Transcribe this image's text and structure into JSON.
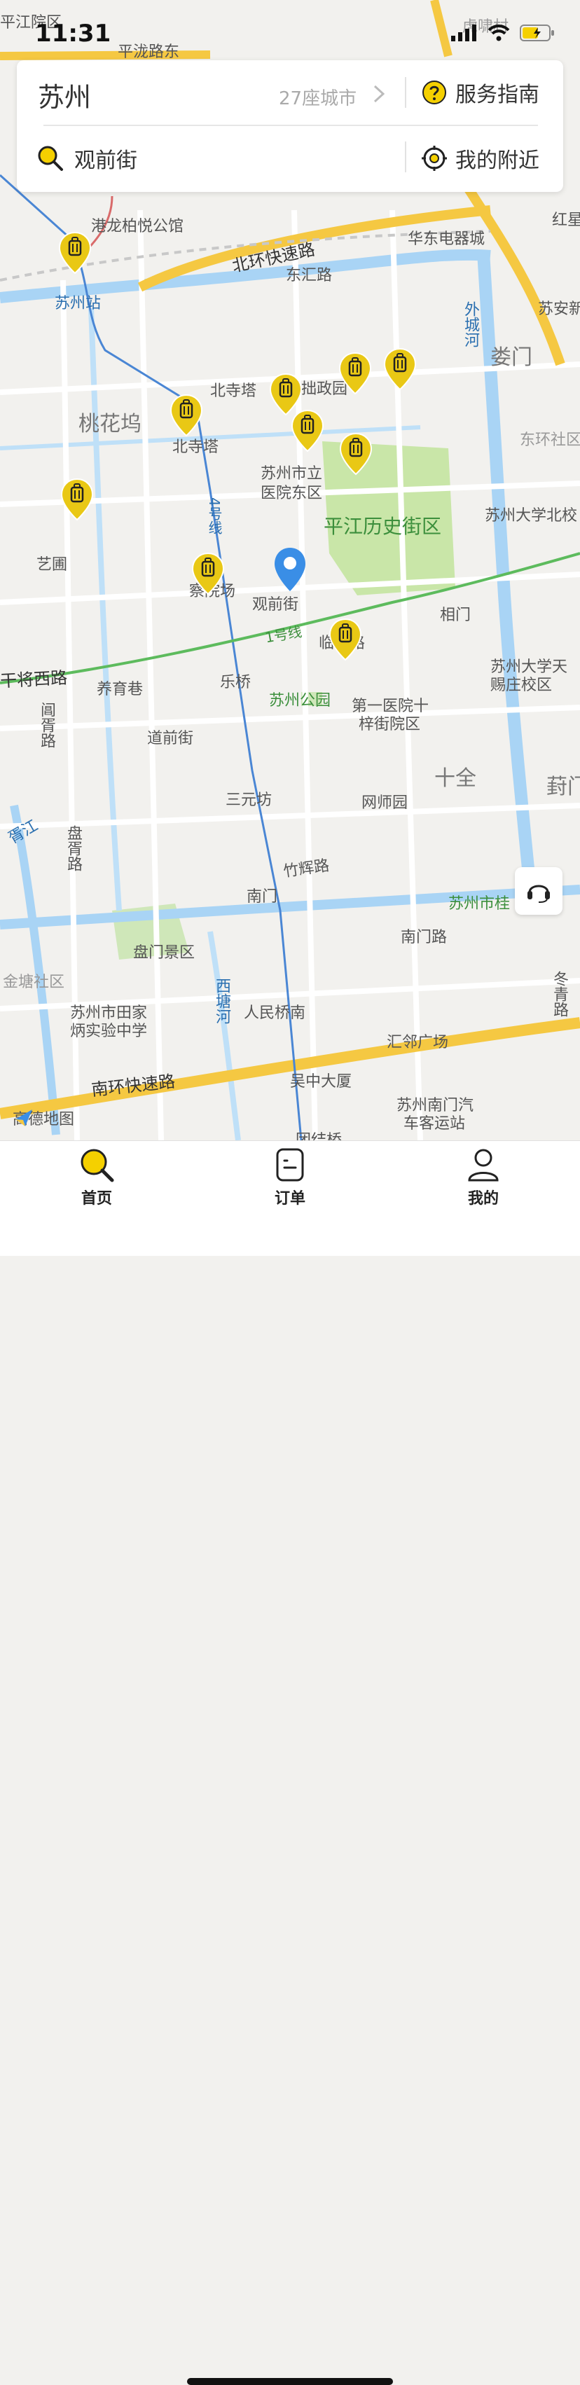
{
  "status_bar": {
    "time": "11:31"
  },
  "header": {
    "city": "苏州",
    "city_count": "27座城市",
    "service_guide": "服务指南",
    "search_value": "观前街",
    "nearby": "我的附近"
  },
  "map": {
    "labels": {
      "gangqlong": "港龙柏悦公馆",
      "suzhou_station": "苏州站",
      "north_ring": "北环快速路",
      "donghui": "东汇路",
      "huadong": "华东电器城",
      "hongxing": "红星",
      "suan": "苏安新",
      "waicheng": "外城河",
      "loumen": "娄门",
      "beisita_poi": "北寺塔",
      "zhuozheng": "拙政园",
      "taohuawu": "桃花坞",
      "beisita_station": "北寺塔",
      "hospital_1": "苏州市立",
      "hospital_2": "医院东区",
      "dongshou": "东环社区",
      "pingjiang": "平江历史街区",
      "suzhou_univ_north": "苏州大学北校",
      "yipu": "艺圃",
      "line4": "4号线",
      "chayuan": "察院场",
      "guanqian": "观前街",
      "line1": "1号线",
      "xiangmen": "相门",
      "lindun": "临顿路",
      "ganjiang": "干将西路",
      "yangyuxiang": "养育巷",
      "leqiao": "乐桥",
      "park": "苏州公园",
      "first_hospital_1": "第一医院十",
      "first_hospital_2": "梓街院区",
      "univ_tianci_1": "苏州大学天",
      "univ_tianci_2": "赐庄校区",
      "changxu": "阊胥路",
      "daoqian": "道前街",
      "shiquan": "十全",
      "fengmen": "葑门",
      "sanyuanfang": "三元坊",
      "wangshi": "网师园",
      "panxu": "盘胥路",
      "xujiang": "胥江",
      "zhuhui": "竹辉路",
      "nanmen": "南门",
      "suzhou_gui": "苏州市桂",
      "nanmen_road": "南门路",
      "panmen": "盘门景区",
      "jintang": "金塘社区",
      "xitang": "西塘河",
      "renmin_bridge": "人民桥南",
      "dongqing": "冬青路",
      "tianjia_1": "苏州市田家",
      "tianjia_2": "炳实验中学",
      "huiling": "汇邻广场",
      "south_ring": "南环快速路",
      "wuzhong": "吴中大厦",
      "nanmen_bus_1": "苏州南门汽",
      "nanmen_bus_2": "车客运站",
      "tuanjie": "团结桥",
      "pingjiang_top": "平江院区",
      "pinglong": "平泷路东",
      "hubei": "虎啸村",
      "amap": "高德地图"
    }
  },
  "tabs": [
    {
      "label": "首页",
      "icon": "search-icon",
      "active": true
    },
    {
      "label": "订单",
      "icon": "order-icon",
      "active": false
    },
    {
      "label": "我的",
      "icon": "user-icon",
      "active": false
    }
  ],
  "colors": {
    "accent": "#f5d000",
    "pin_fill": "#e9c815",
    "location_blue": "#3a8ee6",
    "highway": "#f5c842",
    "river": "#a9d4f5",
    "metro_line1": "#5dbb5d",
    "metro_line4": "#4a86d4"
  }
}
